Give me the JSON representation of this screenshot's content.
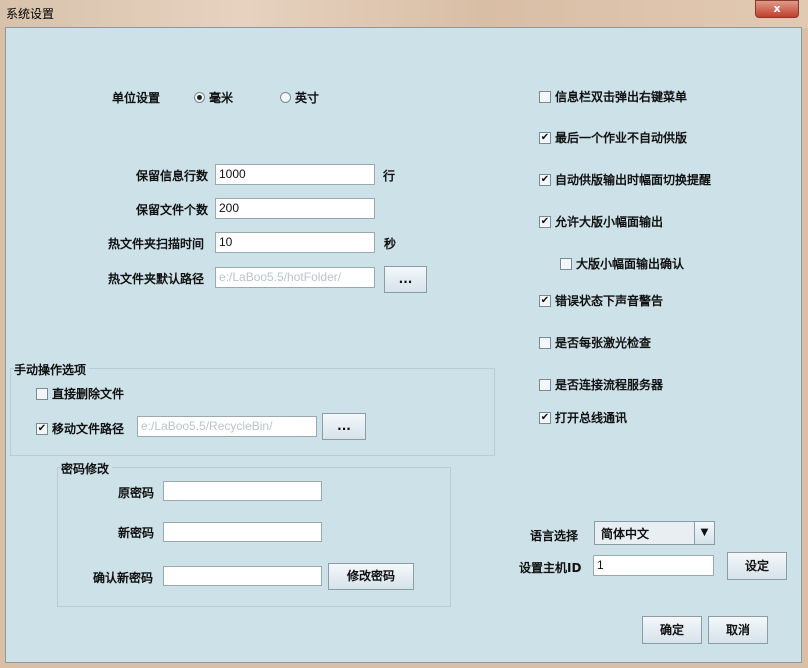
{
  "window": {
    "title": "系统设置",
    "close": "x"
  },
  "unit": {
    "label": "单位设置",
    "options": [
      {
        "label": "毫米",
        "selected": true
      },
      {
        "label": "英寸",
        "selected": false
      }
    ]
  },
  "fields": {
    "info_lines": {
      "label": "保留信息行数",
      "value": "1000",
      "unit": "行"
    },
    "file_count": {
      "label": "保留文件个数",
      "value": "200"
    },
    "scan_time": {
      "label": "热文件夹扫描时间",
      "value": "10",
      "unit": "秒"
    },
    "hot_path": {
      "label": "热文件夹默认路径",
      "value": "e:/LaBoo5.5/hotFolder/",
      "browse": "..."
    }
  },
  "manual": {
    "title": "手动操作选项",
    "delete": {
      "label": "直接删除文件",
      "checked": false
    },
    "move": {
      "label": "移动文件路径",
      "checked": true,
      "value": "e:/LaBoo5.5/RecycleBin/",
      "browse": "..."
    }
  },
  "password": {
    "title": "密码修改",
    "old": "原密码",
    "new": "新密码",
    "confirm": "确认新密码",
    "button": "修改密码"
  },
  "options": [
    {
      "label": "信息栏双击弹出右键菜单",
      "checked": false
    },
    {
      "label": "最后一个作业不自动供版",
      "checked": true
    },
    {
      "label": "自动供版输出时幅面切换提醒",
      "checked": true
    },
    {
      "label": "允许大版小幅面输出",
      "checked": true
    },
    {
      "label": "大版小幅面输出确认",
      "checked": false
    },
    {
      "label": "错误状态下声音警告",
      "checked": true
    },
    {
      "label": "是否每张激光检查",
      "checked": false
    },
    {
      "label": "是否连接流程服务器",
      "checked": false
    },
    {
      "label": "打开总线通讯",
      "checked": true
    }
  ],
  "language": {
    "label": "语言选择",
    "value": "简体中文"
  },
  "host": {
    "label": "设置主机ID",
    "value": "1",
    "button": "设定"
  },
  "footer": {
    "ok": "确定",
    "cancel": "取消"
  }
}
